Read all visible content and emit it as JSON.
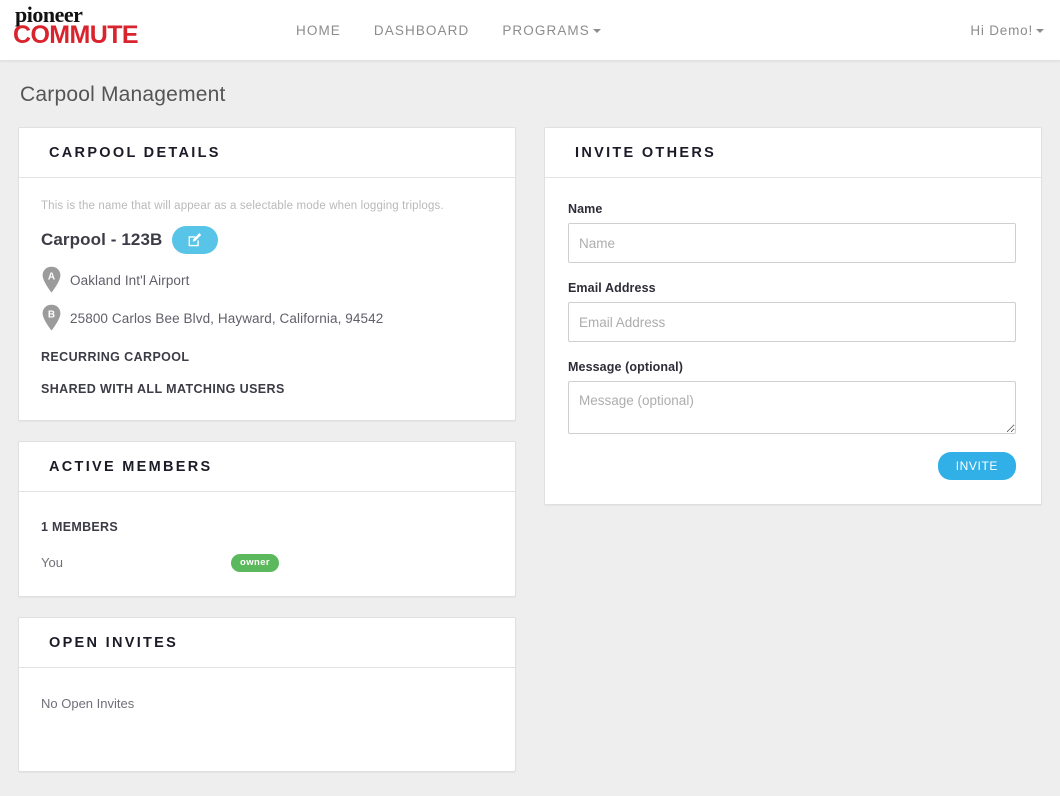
{
  "navbar": {
    "brand": {
      "line1": "pioneer",
      "line2": "COMMUTE"
    },
    "links": [
      {
        "label": "HOME",
        "name": "nav-link-home"
      },
      {
        "label": "DASHBOARD",
        "name": "nav-link-dashboard"
      },
      {
        "label": "PROGRAMS",
        "name": "nav-link-programs",
        "has_caret": true
      }
    ],
    "user_menu": {
      "label": "Hi Demo!",
      "has_caret": true
    }
  },
  "page": {
    "title": "Carpool Management"
  },
  "carpool_details": {
    "header": "CARPOOL DETAILS",
    "hint": "This is the name that will appear as a selectable mode when logging triplogs.",
    "name": "Carpool - 123B",
    "edit_button_label": "",
    "locations": [
      {
        "marker": "A",
        "address": "Oakland Int'l Airport"
      },
      {
        "marker": "B",
        "address": "25800 Carlos Bee Blvd, Hayward, California, 94542"
      }
    ],
    "flags": [
      "RECURRING CARPOOL",
      "SHARED WITH ALL MATCHING USERS"
    ]
  },
  "active_members": {
    "header": "ACTIVE MEMBERS",
    "count_label": "1 MEMBERS",
    "members": [
      {
        "name": "You",
        "badge": "owner"
      }
    ]
  },
  "open_invites": {
    "header": "OPEN INVITES",
    "empty_text": "No Open Invites"
  },
  "invite_others": {
    "header": "INVITE OTHERS",
    "fields": {
      "name": {
        "label": "Name",
        "placeholder": "Name",
        "value": ""
      },
      "email": {
        "label": "Email Address",
        "placeholder": "Email Address",
        "value": ""
      },
      "message": {
        "label": "Message (optional)",
        "placeholder": "Message (optional)",
        "value": ""
      }
    },
    "submit_label": "INVITE"
  },
  "colors": {
    "brand_red": "#d9232d",
    "accent_blue": "#31b0e8",
    "edit_blue": "#58c4e8",
    "owner_green": "#5cb85c",
    "page_bg": "#eeeeee",
    "pin_gray": "#9b9b9b"
  }
}
